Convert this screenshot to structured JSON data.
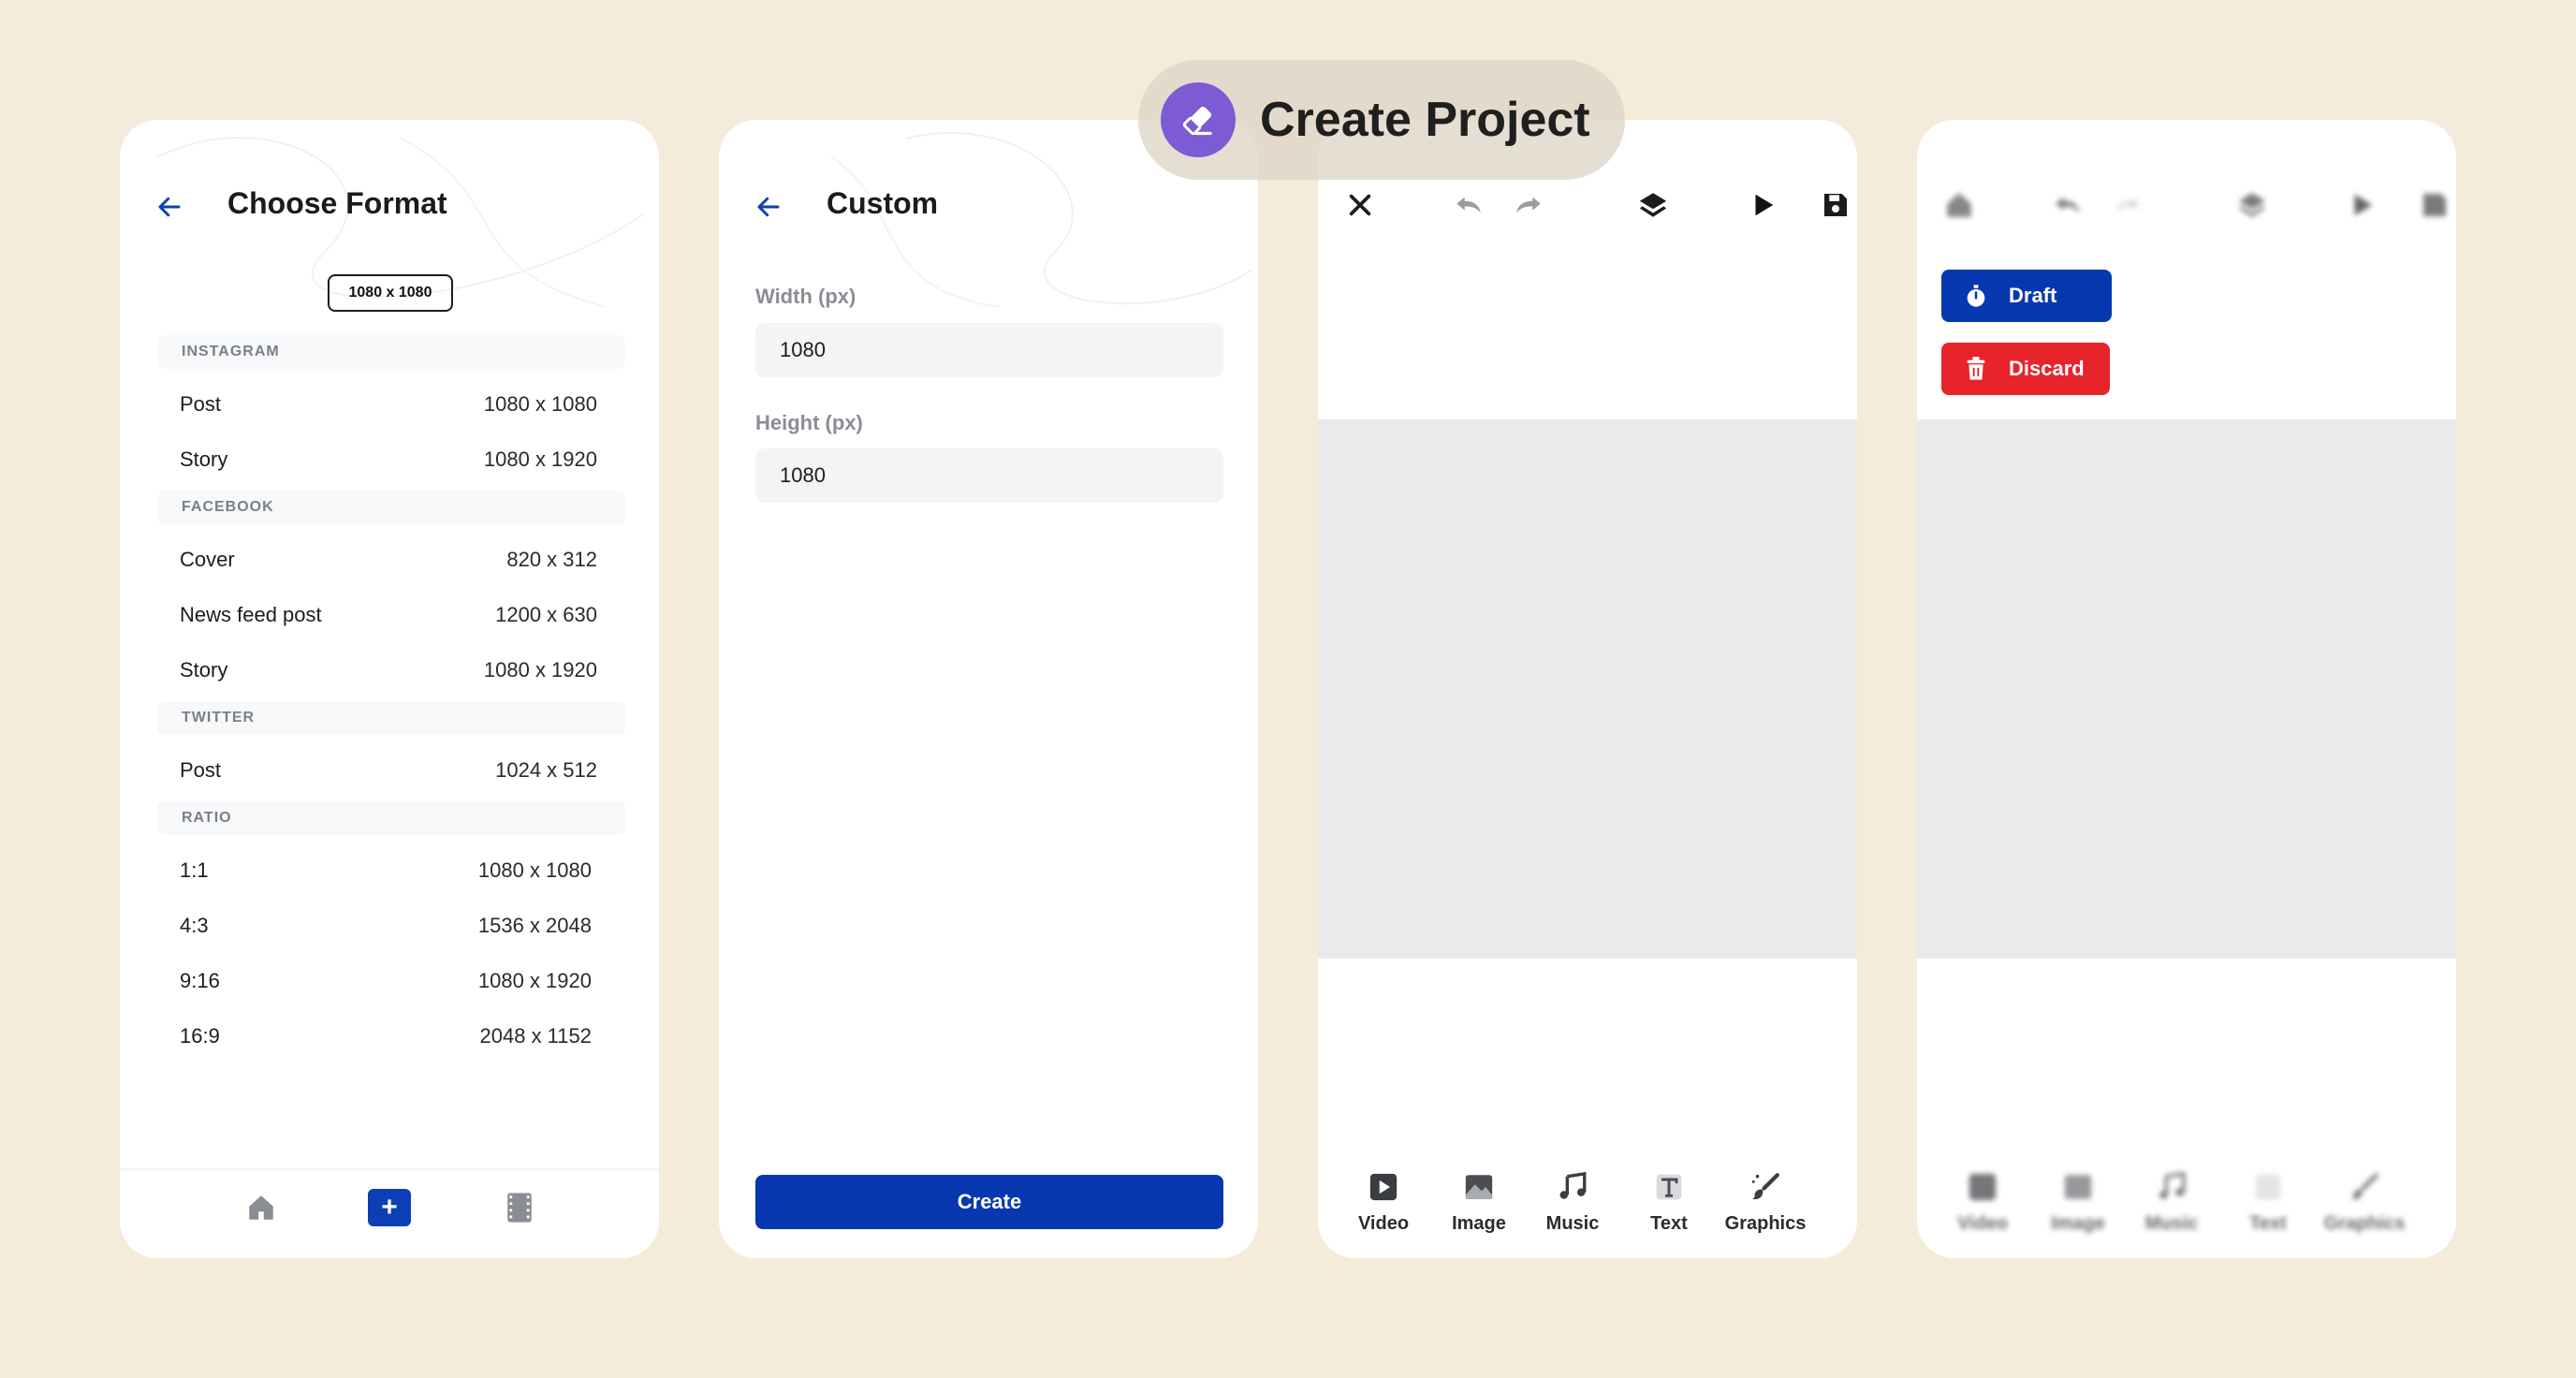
{
  "badge": {
    "title": "Create Project",
    "icon": "eraser-icon",
    "color": "#7c5bd4"
  },
  "choose_format": {
    "title": "Choose Format",
    "selected_chip": "1080 x 1080",
    "sections": [
      {
        "name": "INSTAGRAM",
        "items": [
          {
            "label": "Post",
            "size": "1080 x 1080"
          },
          {
            "label": "Story",
            "size": "1080 x 1920"
          }
        ]
      },
      {
        "name": "FACEBOOK",
        "items": [
          {
            "label": "Cover",
            "size": "820 x 312"
          },
          {
            "label": "News feed post",
            "size": "1200 x 630"
          },
          {
            "label": "Story",
            "size": "1080 x 1920"
          }
        ]
      },
      {
        "name": "TWITTER",
        "items": [
          {
            "label": "Post",
            "size": "1024 x 512"
          }
        ]
      },
      {
        "name": "RATIO",
        "items": [
          {
            "label": "1:1",
            "size": "1080 x 1080"
          },
          {
            "label": "4:3",
            "size": "1536 x 2048"
          },
          {
            "label": "9:16",
            "size": "1080 x 1920"
          },
          {
            "label": "16:9",
            "size": "2048 x 1152"
          }
        ]
      }
    ],
    "nav": [
      "home-icon",
      "plus-icon",
      "film-icon"
    ]
  },
  "custom": {
    "title": "Custom",
    "width_label": "Width (px)",
    "width_value": "1080",
    "height_label": "Height (px)",
    "height_value": "1080",
    "create_label": "Create"
  },
  "editor": {
    "toolbar": [
      "close-icon",
      "undo-icon",
      "redo-icon",
      "layers-icon",
      "play-icon",
      "save-icon"
    ],
    "tools": [
      {
        "label": "Video",
        "icon": "video-icon"
      },
      {
        "label": "Image",
        "icon": "image-icon"
      },
      {
        "label": "Music",
        "icon": "music-icon"
      },
      {
        "label": "Text",
        "icon": "text-icon"
      },
      {
        "label": "Graphics",
        "icon": "brush-icon"
      }
    ]
  },
  "exit_menu": {
    "draft_label": "Draft",
    "discard_label": "Discard",
    "draft_color": "#0838b0",
    "discard_color": "#e7232b",
    "tools": [
      "Video",
      "Image",
      "Music",
      "Text",
      "Graphics"
    ]
  }
}
